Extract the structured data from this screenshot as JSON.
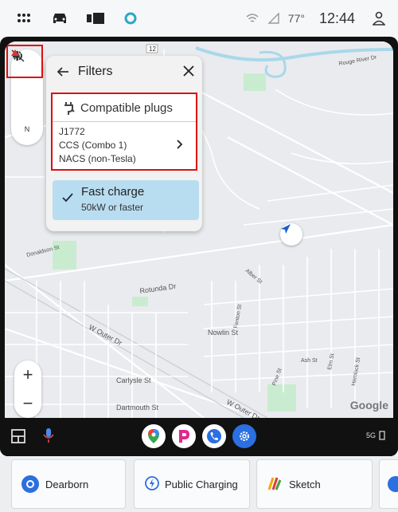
{
  "statusbar": {
    "temperature": "77°",
    "time": "12:44",
    "icons": [
      "apps-grid-icon",
      "car-icon",
      "media-icon",
      "assistant-icon",
      "wifi-icon",
      "signal-icon",
      "profile-icon"
    ]
  },
  "map_controls": {
    "settings_icon": "gear-icon",
    "mute_icon": "volume-off-icon",
    "compass_label": "N",
    "zoom_in": "+",
    "zoom_out": "−",
    "attribution": "Google"
  },
  "filters_panel": {
    "title": "Filters",
    "plugs": {
      "title": "Compatible plugs",
      "items": [
        "J1772",
        "CCS (Combo 1)",
        "NACS (non-Tesla)"
      ]
    },
    "fast_charge": {
      "title": "Fast charge",
      "subtitle": "50kW or faster",
      "selected": true
    }
  },
  "map_labels": {
    "streets": [
      "Rotunda Dr",
      "W Outer Dr",
      "W Outer Dr",
      "Nowlin St",
      "Carlysle St",
      "Dartmouth St",
      "Rouge River Dr",
      "Donaldson St",
      "Pine St",
      "Ash St",
      "Hemlock St",
      "Elm St",
      "Alber St",
      "Fenton St"
    ],
    "route_number": "12"
  },
  "dock": {
    "apps": [
      "maps-icon",
      "pandora-icon",
      "phone-icon",
      "settings-icon"
    ],
    "status": "5G"
  },
  "bottom_bar": {
    "cards": [
      {
        "label": "Dearborn",
        "icon": "location-icon"
      },
      {
        "label": "Public Charging",
        "icon": "charging-icon"
      },
      {
        "label": "Sketch",
        "icon": "sketch-icon"
      }
    ]
  },
  "colors": {
    "highlight": "#d11111",
    "fast_charge_bg": "#b9ddf0",
    "nav_arrow": "#1a5fd0"
  }
}
